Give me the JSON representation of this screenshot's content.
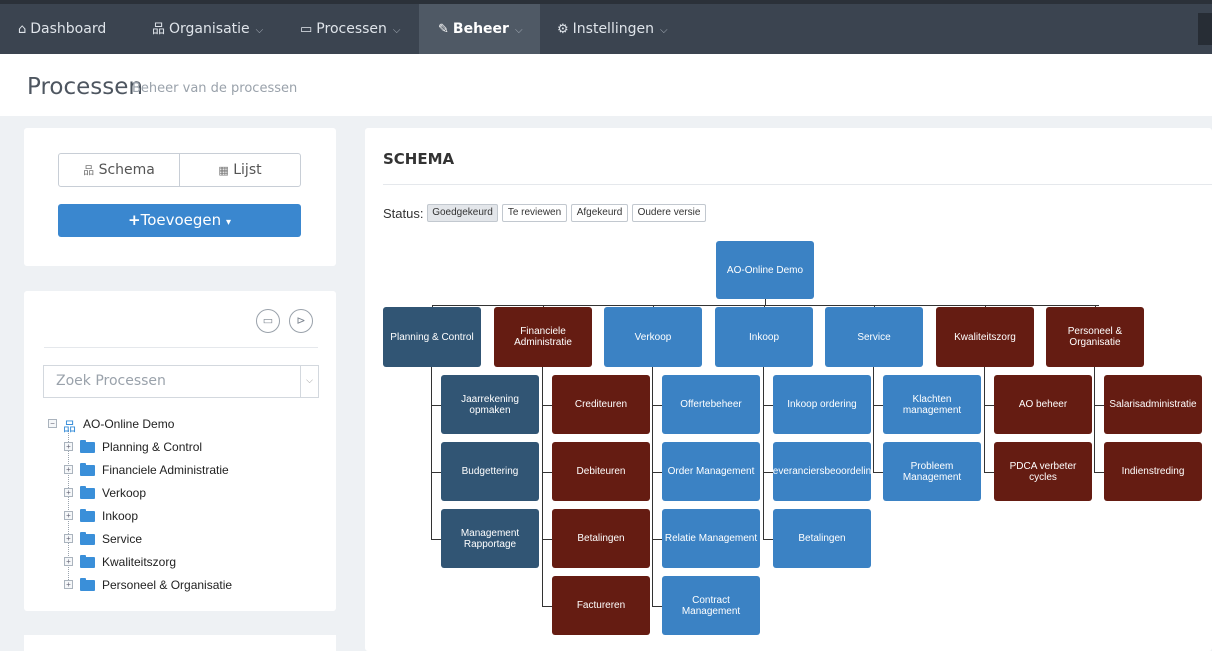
{
  "nav": {
    "items": [
      {
        "label": "Dashboard",
        "icon": "home-icon",
        "glyph": "⌂",
        "chevron": false,
        "active": false
      },
      {
        "label": "Organisatie",
        "icon": "sitemap-icon",
        "glyph": "品",
        "chevron": true,
        "active": false
      },
      {
        "label": "Processen",
        "icon": "monitor-icon",
        "glyph": "▭",
        "chevron": true,
        "active": false
      },
      {
        "label": "Beheer",
        "icon": "edit-icon",
        "glyph": "✎",
        "chevron": true,
        "active": true
      },
      {
        "label": "Instellingen",
        "icon": "gear-icon",
        "glyph": "⚙",
        "chevron": true,
        "active": false
      }
    ]
  },
  "page": {
    "title": "Processen",
    "subtitle": "Beheer van de processen"
  },
  "sidebar": {
    "schema_label": "Schema",
    "lijst_label": "Lijst",
    "add_label": "Toevoegen",
    "search_placeholder": "Zoek Processen",
    "tree_root": "AO-Online Demo",
    "tree_items": [
      "Planning & Control",
      "Financiele Administratie",
      "Verkoop",
      "Inkoop",
      "Service",
      "Kwaliteitszorg",
      "Personeel & Organisatie"
    ]
  },
  "schema": {
    "heading": "SCHEMA",
    "status_label": "Status:",
    "status_options": [
      "Goedgekeurd",
      "Te reviewen",
      "Afgekeurd",
      "Oudere versie"
    ],
    "root": "AO-Online Demo",
    "columns": [
      {
        "label": "Planning & Control",
        "color": "dark",
        "children": [
          {
            "label": "Jaarrekening opmaken",
            "color": "dark"
          },
          {
            "label": "Budgettering",
            "color": "dark"
          },
          {
            "label": "Management Rapportage",
            "color": "dark"
          }
        ]
      },
      {
        "label": "Financiele Administratie",
        "color": "red",
        "children": [
          {
            "label": "Crediteuren",
            "color": "red"
          },
          {
            "label": "Debiteuren",
            "color": "red"
          },
          {
            "label": "Betalingen",
            "color": "red"
          },
          {
            "label": "Factureren",
            "color": "red"
          }
        ]
      },
      {
        "label": "Verkoop",
        "color": "blue",
        "children": [
          {
            "label": "Offertebeheer",
            "color": "blue"
          },
          {
            "label": "Order Management",
            "color": "blue"
          },
          {
            "label": "Relatie Management",
            "color": "blue"
          },
          {
            "label": "Contract Management",
            "color": "blue"
          }
        ]
      },
      {
        "label": "Inkoop",
        "color": "blue",
        "children": [
          {
            "label": "Inkoop ordering",
            "color": "blue"
          },
          {
            "label": "Leveranciersbeoordeling",
            "color": "blue"
          },
          {
            "label": "Betalingen",
            "color": "blue"
          }
        ]
      },
      {
        "label": "Service",
        "color": "blue",
        "children": [
          {
            "label": "Klachten management",
            "color": "blue"
          },
          {
            "label": "Probleem Management",
            "color": "blue"
          }
        ]
      },
      {
        "label": "Kwaliteitszorg",
        "color": "red",
        "children": [
          {
            "label": "AO beheer",
            "color": "red"
          },
          {
            "label": "PDCA verbeter cycles",
            "color": "red"
          }
        ]
      },
      {
        "label": "Personeel & Organisatie",
        "color": "red",
        "children": [
          {
            "label": "Salarisadministratie",
            "color": "red"
          },
          {
            "label": "Indienstreding",
            "color": "red"
          }
        ]
      }
    ]
  },
  "colors": {
    "dark": "#315574",
    "red": "#651c12",
    "blue": "#3b82c4",
    "nav": "#3b4450",
    "accent": "#3a87cf"
  }
}
